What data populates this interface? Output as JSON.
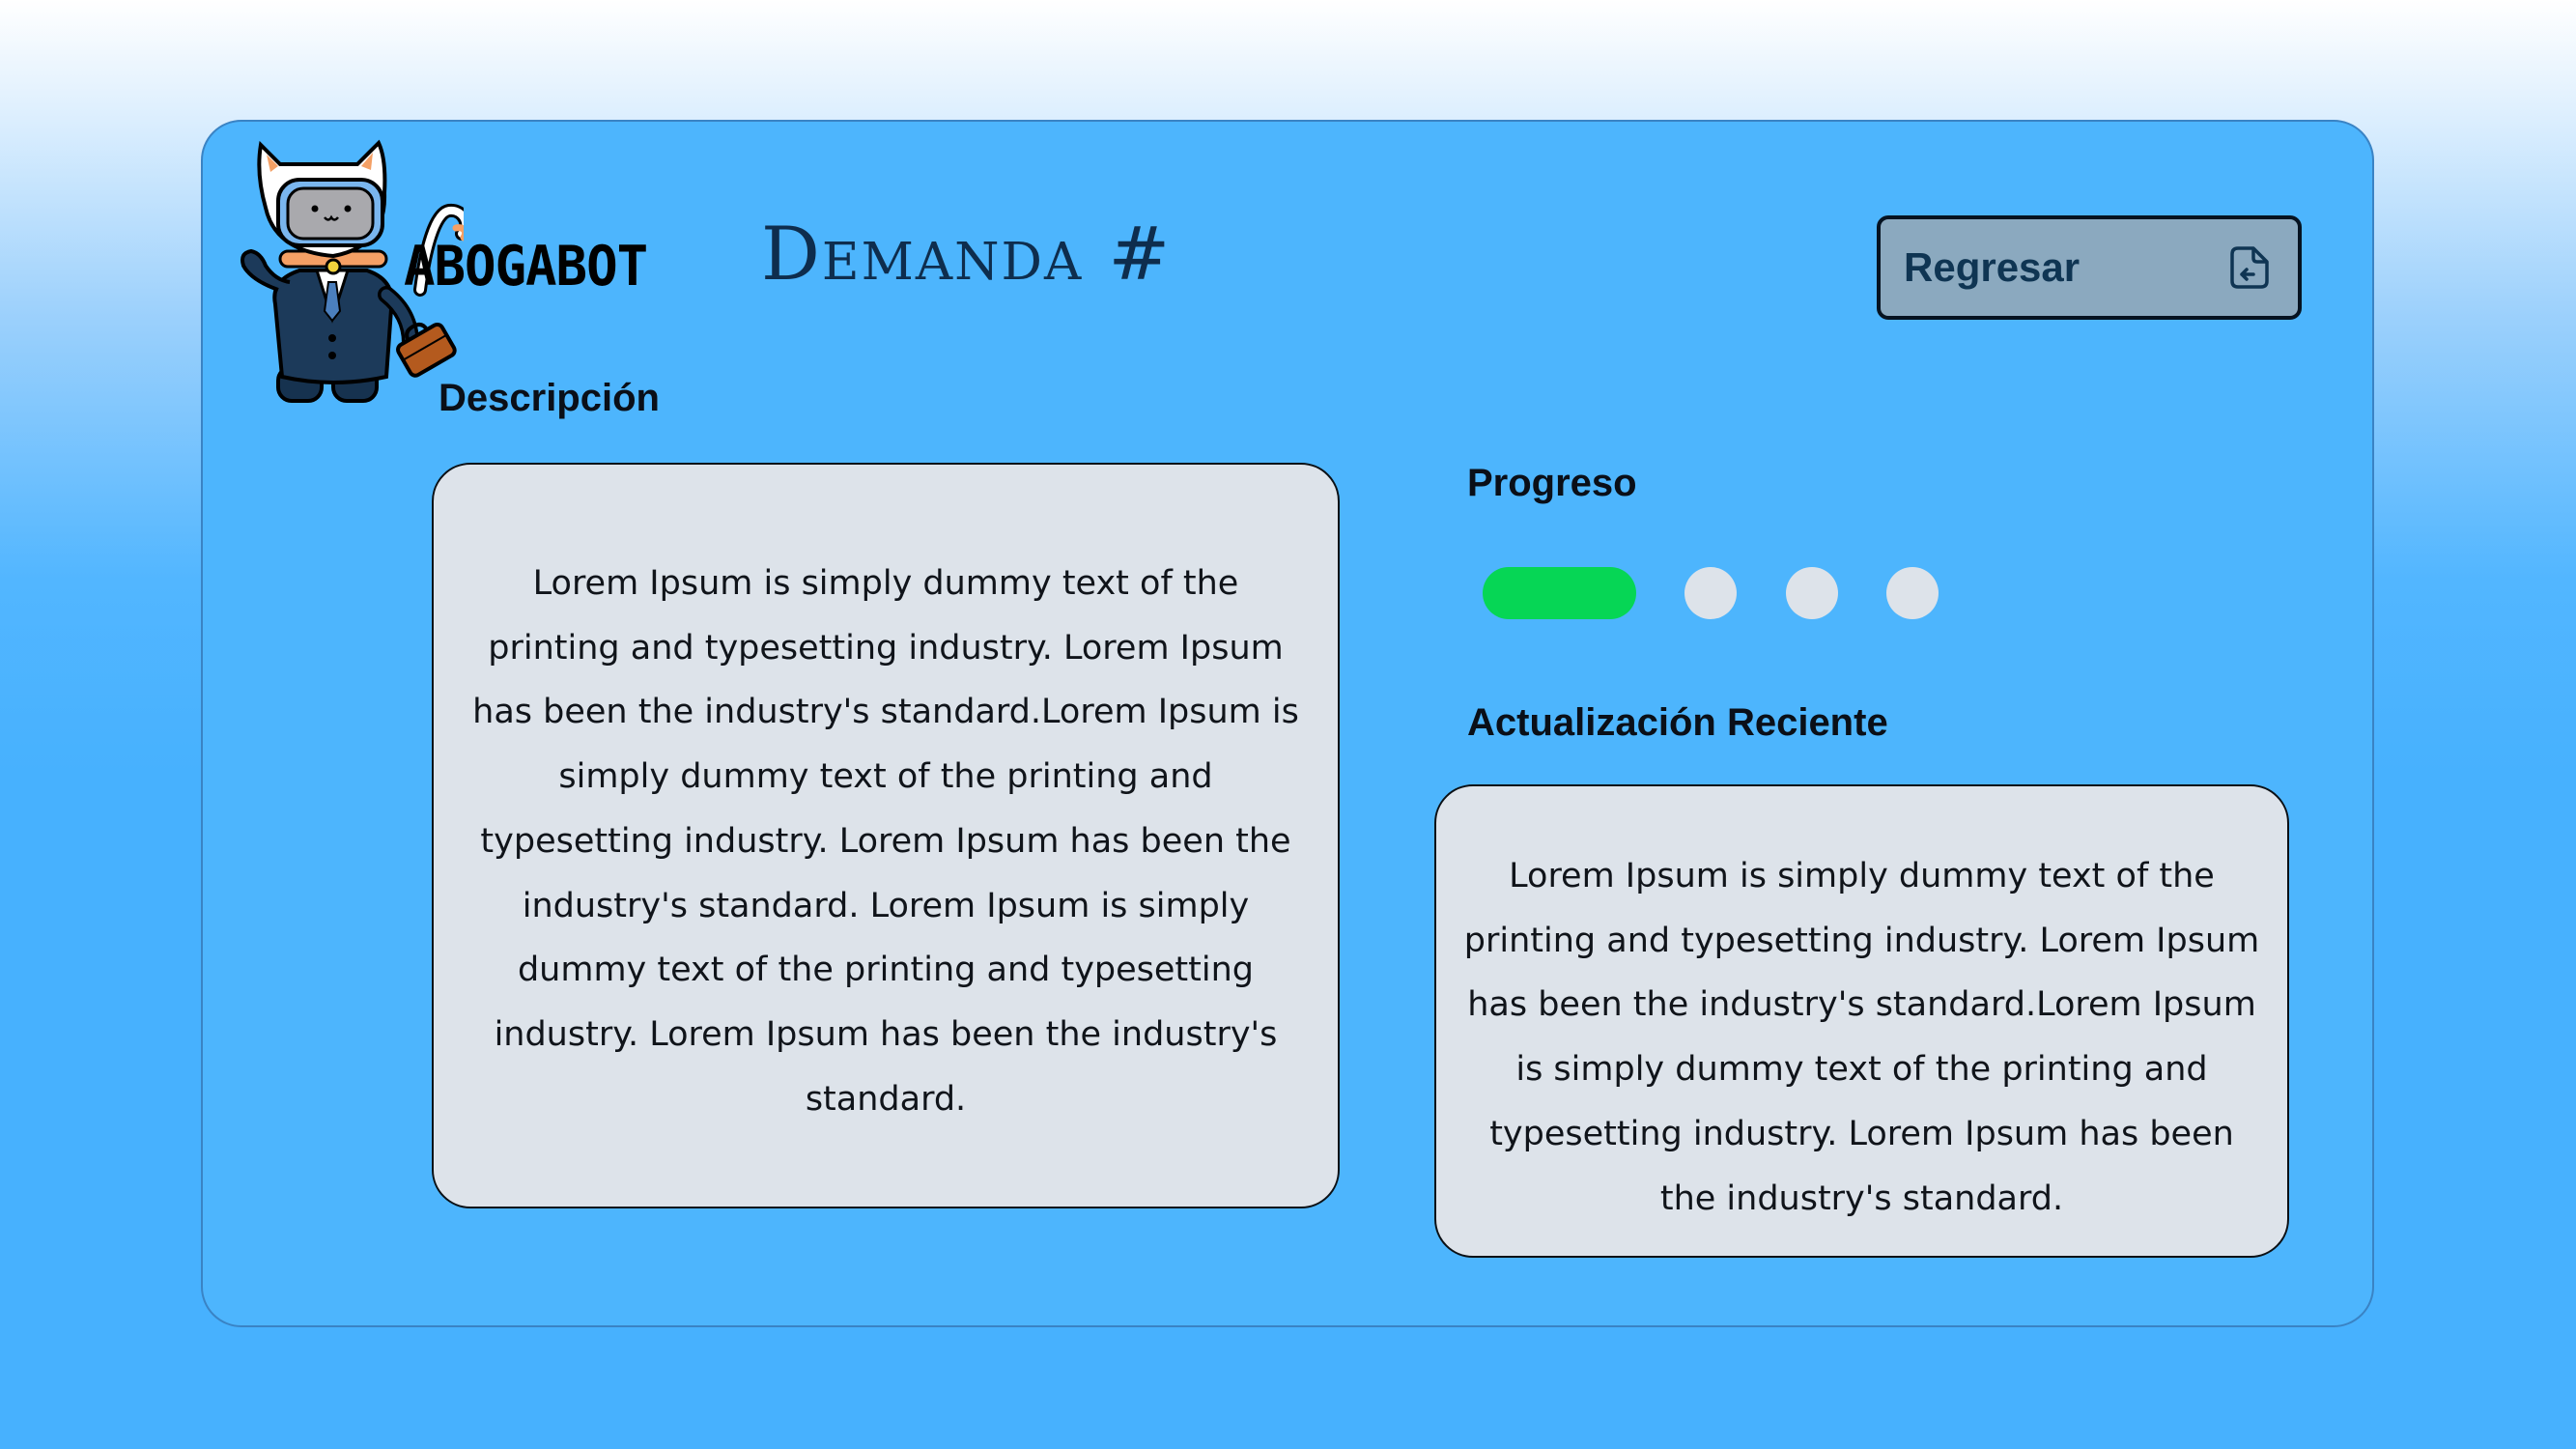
{
  "logo": {
    "text": "ABOGABOT",
    "mascot_icon": "cat-robot-lawyer-icon"
  },
  "header": {
    "title": "Demanda #"
  },
  "back_button": {
    "label": "Regresar",
    "icon": "document-return-icon"
  },
  "description": {
    "label": "Descripción",
    "text": "Lorem Ipsum is simply dummy text of the printing and typesetting industry. Lorem Ipsum has been the industry's standard.Lorem Ipsum is simply dummy text of the printing and typesetting industry. Lorem Ipsum has been the industry's standard. Lorem Ipsum is simply dummy text of the printing and typesetting industry. Lorem Ipsum has been the industry's standard."
  },
  "progress": {
    "label": "Progreso",
    "total_steps": 4,
    "current_step": 1
  },
  "recent_update": {
    "label": "Actualización Reciente",
    "text": "Lorem Ipsum is simply dummy text of the printing and typesetting industry. Lorem Ipsum has been the industry's standard.Lorem Ipsum is simply dummy text of the printing and typesetting industry. Lorem Ipsum has been the industry's standard."
  },
  "colors": {
    "background": "#47b1fe",
    "card": "#4db5fd",
    "button": "#8ba9bf",
    "panel": "#dde3ea",
    "progress_active": "#06d655",
    "title": "#0e2d4d"
  }
}
